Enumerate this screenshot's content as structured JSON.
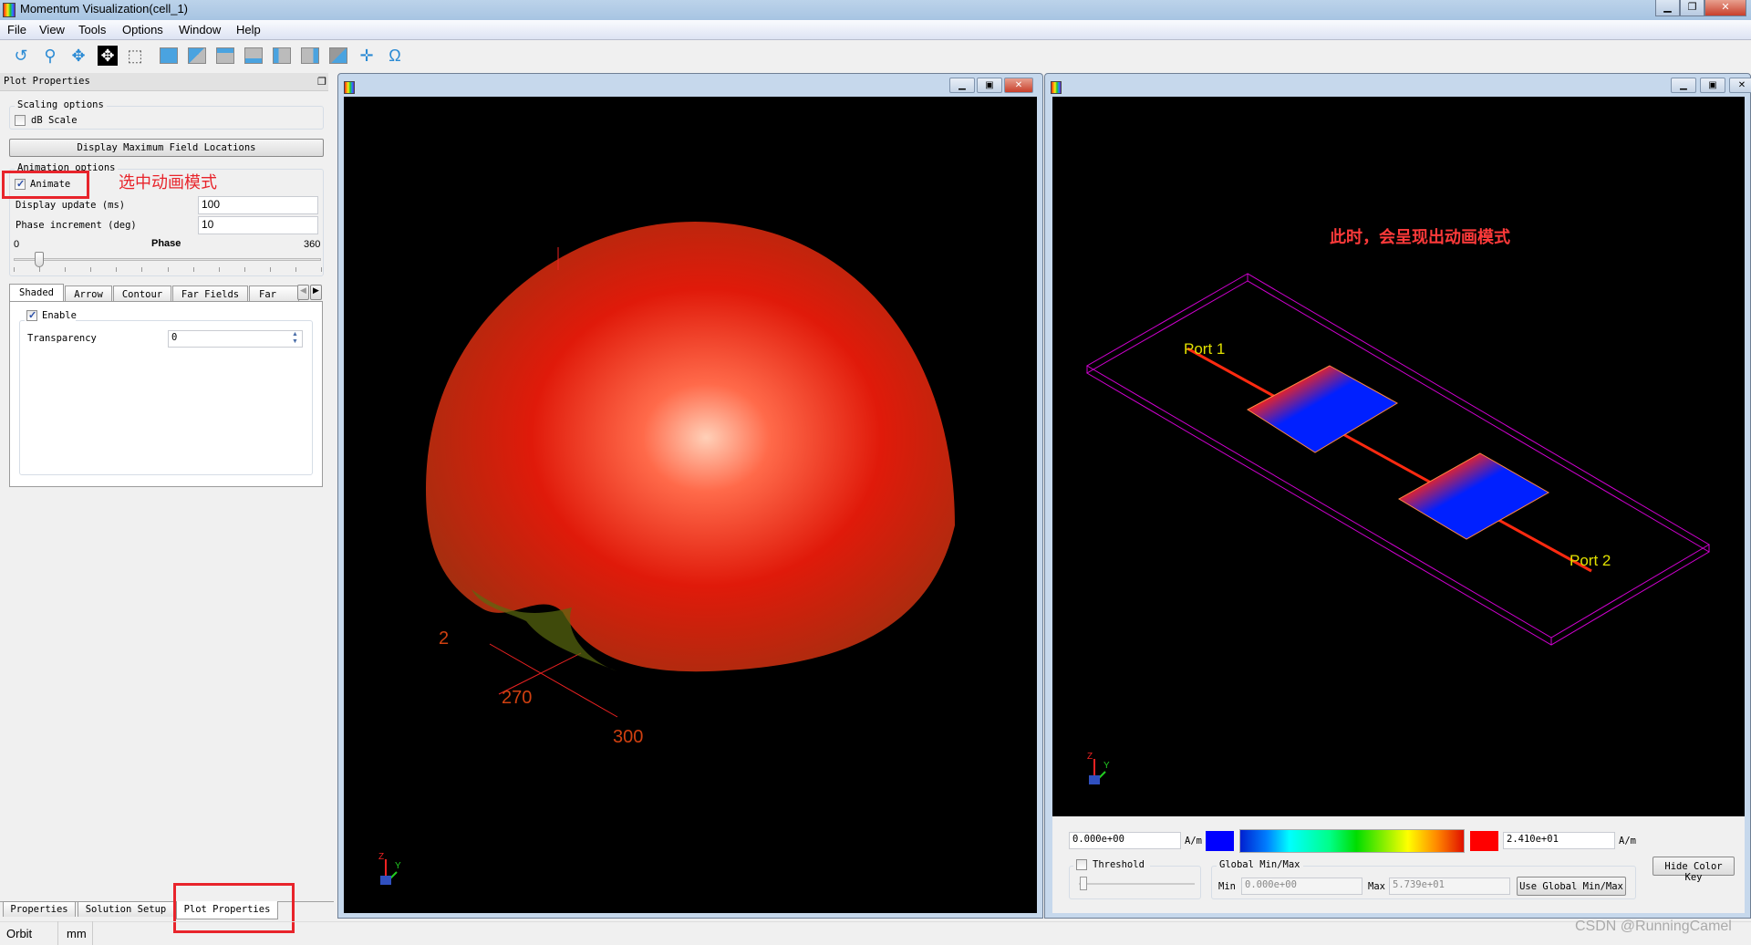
{
  "window": {
    "title": "Momentum Visualization(cell_1)",
    "minimize": "▁",
    "restore": "❐",
    "close": "✕"
  },
  "menu": [
    "File",
    "View",
    "Tools",
    "Options",
    "Window",
    "Help"
  ],
  "toolbar": [
    "rotate-icon",
    "zoom-icon",
    "pan-icon",
    "move-icon",
    "zoom-box-icon",
    "view-front-icon",
    "view-back-icon",
    "view-top-icon",
    "view-bottom-icon",
    "view-left-icon",
    "view-right-icon",
    "view-iso-icon",
    "crosshair-icon",
    "omega-icon"
  ],
  "left_panel": {
    "title": "Plot Properties",
    "scaling": {
      "label": "Scaling options",
      "db_scale": "dB Scale",
      "db_checked": false
    },
    "display_max_button": "Display Maximum Field Locations",
    "animation": {
      "label": "Animation options",
      "animate": "Animate",
      "animate_checked": true,
      "annotation": "选中动画模式",
      "display_update_label": "Display update (ms)",
      "display_update": "100",
      "phase_increment_label": "Phase increment (deg)",
      "phase_increment": "10",
      "phase_label": "Phase",
      "phase_min": "0",
      "phase_max": "360",
      "phase_value": 30
    },
    "tabs": [
      "Shaded",
      "Arrow",
      "Contour",
      "Far Fields",
      "Far Fie"
    ],
    "active_tab": "Shaded",
    "shaded": {
      "enable": "Enable",
      "enable_checked": true,
      "transparency_label": "Transparency",
      "transparency": "0"
    }
  },
  "bottom_tabs": [
    "Properties",
    "Solution Setup",
    "Plot Properties"
  ],
  "status": {
    "mode": "Orbit",
    "units": "mm"
  },
  "left_view": {
    "labels": [
      "2",
      "270",
      "300"
    ],
    "axes": [
      "Z",
      "Y"
    ]
  },
  "right_view": {
    "annotation": "此时，会呈现出动画模式",
    "port1": "Port 1",
    "port2": "Port 2",
    "axes": [
      "Z",
      "Y"
    ]
  },
  "color_key": {
    "min": "0.000e+00",
    "max": "2.410e+01",
    "unit": "A/m",
    "threshold": "Threshold",
    "threshold_checked": false,
    "global_label": "Global Min/Max",
    "global_min_label": "Min",
    "global_min": "0.000e+00",
    "global_max_label": "Max",
    "global_max": "5.739e+01",
    "use_global": "Use Global Min/Max",
    "hide_key": "Hide Color Key"
  },
  "watermark": "CSDN @RunningCamel"
}
